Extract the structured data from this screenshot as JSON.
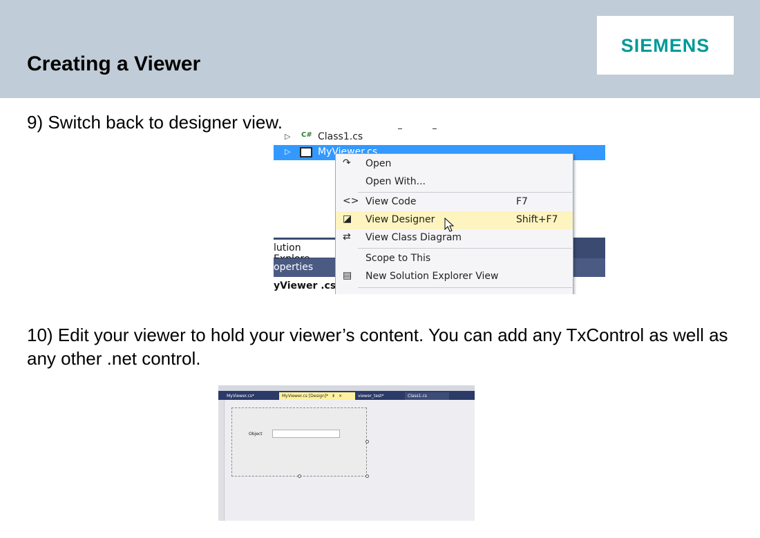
{
  "slide": {
    "title": "Creating a Viewer",
    "logo": "SIEMENS",
    "step9": "9) Switch back to designer view.",
    "step10": "10) Edit your viewer to hold your viewer’s content. You can add any TxControl as well as any other .net control."
  },
  "solution_explorer": {
    "rows": [
      {
        "icon": "C#",
        "label": "Class1.cs"
      },
      {
        "icon": "form-icon",
        "label": "MyViewer.cs"
      }
    ],
    "panel_label": "lution Explore",
    "properties_label": "operties",
    "file_label": "yViewer .cs"
  },
  "context_menu": {
    "items": [
      {
        "icon": "redo-arrow-icon",
        "label": "Open",
        "shortcut": ""
      },
      {
        "icon": "",
        "label": "Open With...",
        "shortcut": ""
      },
      {
        "icon": "code-brackets-icon",
        "label": "View Code",
        "shortcut": "F7"
      },
      {
        "icon": "designer-icon",
        "label": "View Designer",
        "shortcut": "Shift+F7"
      },
      {
        "icon": "class-diagram-icon",
        "label": "View Class Diagram",
        "shortcut": ""
      },
      {
        "icon": "",
        "label": "Scope to This",
        "shortcut": ""
      },
      {
        "icon": "new-explorer-icon",
        "label": "New Solution Explorer View",
        "shortcut": ""
      }
    ],
    "highlight_color": "#fdf4bf"
  },
  "designer": {
    "tabs": [
      "MyViewer.cs*",
      "MyViewer.cs [Design]*",
      "viewer_test*",
      "Class1.cs"
    ],
    "active_tab": "MyViewer.cs [Design]*",
    "tab_pin": "⇟",
    "tab_close": "×",
    "field_label": "Object"
  },
  "colors": {
    "header_bg": "#c0ccd7",
    "logo_text": "#009999",
    "selection": "#3399ff",
    "vs_tab_bar": "#2b3a67",
    "active_tab": "#fff29d"
  }
}
